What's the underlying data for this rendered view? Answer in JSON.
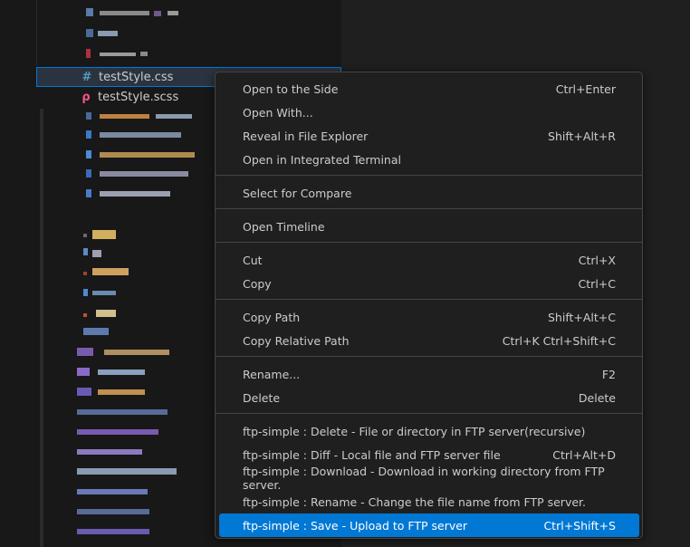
{
  "explorer": {
    "files": [
      {
        "name": "testStyle.css",
        "icon": "css-hash-icon",
        "icon_glyph": "#",
        "icon_color": "#519aba",
        "selected": true
      },
      {
        "name": "testStyle.scss",
        "icon": "sass-icon",
        "icon_glyph": "ρ",
        "icon_color": "#f55385",
        "selected": false
      }
    ]
  },
  "context_menu": {
    "items": [
      {
        "label": "Open to the Side",
        "shortcut": "Ctrl+Enter"
      },
      {
        "label": "Open With...",
        "shortcut": ""
      },
      {
        "label": "Reveal in File Explorer",
        "shortcut": "Shift+Alt+R"
      },
      {
        "label": "Open in Integrated Terminal",
        "shortcut": ""
      },
      {
        "label": "Select for Compare",
        "shortcut": ""
      },
      {
        "label": "Open Timeline",
        "shortcut": ""
      },
      {
        "label": "Cut",
        "shortcut": "Ctrl+X"
      },
      {
        "label": "Copy",
        "shortcut": "Ctrl+C"
      },
      {
        "label": "Copy Path",
        "shortcut": "Shift+Alt+C"
      },
      {
        "label": "Copy Relative Path",
        "shortcut": "Ctrl+K Ctrl+Shift+C"
      },
      {
        "label": "Rename...",
        "shortcut": "F2"
      },
      {
        "label": "Delete",
        "shortcut": "Delete"
      },
      {
        "label": "ftp-simple : Delete - File or directory in FTP server(recursive)",
        "shortcut": ""
      },
      {
        "label": "ftp-simple : Diff - Local file and FTP server file",
        "shortcut": "Ctrl+Alt+D"
      },
      {
        "label": "ftp-simple : Download - Download in working directory from FTP server.",
        "shortcut": ""
      },
      {
        "label": "ftp-simple : Rename - Change the file name from FTP server.",
        "shortcut": ""
      },
      {
        "label": "ftp-simple : Save - Upload to FTP server",
        "shortcut": "Ctrl+Shift+S",
        "highlighted": true
      }
    ]
  },
  "colors": {
    "accent": "#0078d4",
    "menu_background": "#1f1f1f",
    "explorer_background": "#181818"
  }
}
